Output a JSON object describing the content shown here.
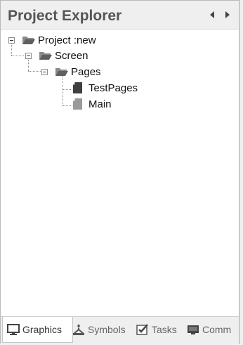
{
  "panel": {
    "title": "Project Explorer"
  },
  "tree": {
    "project": "Project :new",
    "screen": "Screen",
    "pages": "Pages",
    "items": [
      "TestPages",
      "Main"
    ]
  },
  "tabs": [
    {
      "label": "Graphics",
      "icon": "monitor-icon",
      "active": true
    },
    {
      "label": "Symbols",
      "icon": "symbols-icon"
    },
    {
      "label": "Tasks",
      "icon": "tasks-icon"
    },
    {
      "label": "Comm",
      "icon": "comm-icon"
    }
  ],
  "colors": {
    "header_bg": "#efefef",
    "panel_bg": "#ffffff",
    "folder": "#7a7a7a",
    "page_dark": "#3f3f3f",
    "page_light": "#9a9a9a"
  }
}
